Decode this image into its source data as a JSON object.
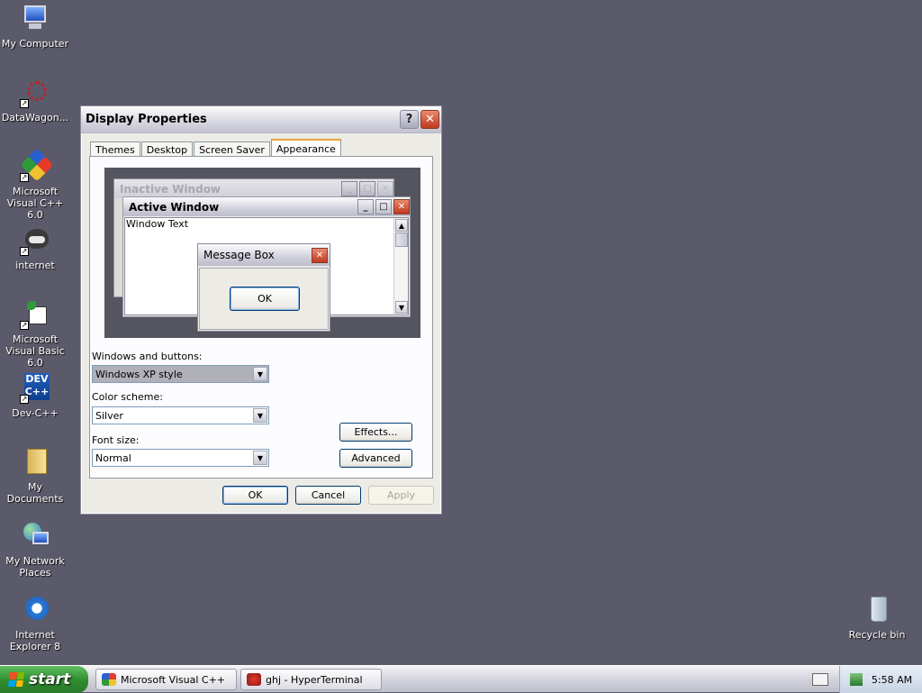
{
  "desktop": {
    "icons": [
      {
        "label": "My Computer",
        "icon": "computer-icon"
      },
      {
        "label": "DataWagon...",
        "icon": "datawagon-icon"
      },
      {
        "label": "Microsoft Visual C++ 6.0",
        "icon": "visual-cpp-icon"
      },
      {
        "label": "internet",
        "icon": "raccoon-icon"
      },
      {
        "label": "Microsoft Visual Basic 6.0",
        "icon": "visual-basic-icon"
      },
      {
        "label": "Dev-C++",
        "icon": "devcpp-icon"
      },
      {
        "label": "My Documents",
        "icon": "folder-icon"
      },
      {
        "label": "My Network Places",
        "icon": "network-icon"
      },
      {
        "label": "Internet Explorer 8",
        "icon": "ie-icon"
      },
      {
        "label": "Recycle bin",
        "icon": "recycle-bin-icon"
      }
    ],
    "background_color": "#5a5a6a"
  },
  "dialog": {
    "title": "Display Properties",
    "help_button": "?",
    "close_button": "✕",
    "tabs": [
      {
        "label": "Themes"
      },
      {
        "label": "Desktop"
      },
      {
        "label": "Screen Saver"
      },
      {
        "label": "Appearance",
        "active": true
      }
    ],
    "preview": {
      "inactive_title": "Inactive Window",
      "active_title": "Active Window",
      "window_text": "Window Text",
      "message_box_title": "Message Box",
      "message_box_ok": "OK"
    },
    "windows_buttons": {
      "label": "Windows and buttons:",
      "value": "Windows XP style"
    },
    "color_scheme": {
      "label": "Color scheme:",
      "value": "Silver"
    },
    "font_size": {
      "label": "Font size:",
      "value": "Normal"
    },
    "effects_button": "Effects...",
    "advanced_button": "Advanced",
    "ok_button": "OK",
    "cancel_button": "Cancel",
    "apply_button": "Apply"
  },
  "taskbar": {
    "start_label": "start",
    "tasks": [
      {
        "label": "Microsoft Visual C++"
      },
      {
        "label": "ghj - HyperTerminal"
      }
    ],
    "clock": "5:58 AM"
  }
}
